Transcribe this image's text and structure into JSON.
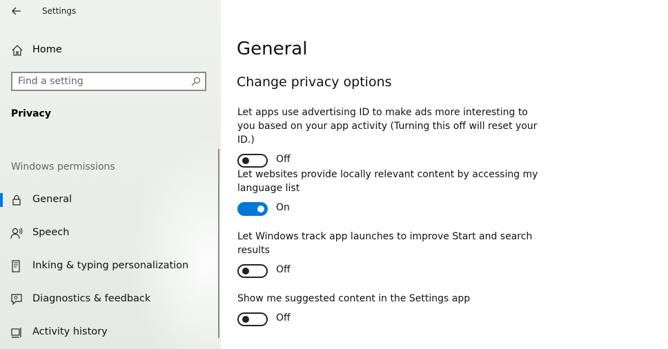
{
  "app": {
    "title": "Settings"
  },
  "sidebar": {
    "home_label": "Home",
    "search_placeholder": "Find a setting",
    "section_title": "Privacy",
    "group_title": "Windows permissions",
    "items": [
      {
        "label": "General",
        "icon": "lock-icon",
        "active": true
      },
      {
        "label": "Speech",
        "icon": "speech-icon",
        "active": false
      },
      {
        "label": "Inking & typing personalization",
        "icon": "inking-icon",
        "active": false
      },
      {
        "label": "Diagnostics & feedback",
        "icon": "feedback-icon",
        "active": false
      },
      {
        "label": "Activity history",
        "icon": "activity-history-icon",
        "active": false
      }
    ]
  },
  "main": {
    "title": "General",
    "subtitle": "Change privacy options",
    "settings": [
      {
        "desc": "Let apps use advertising ID to make ads more interesting to you based on your app activity (Turning this off will reset your ID.)",
        "state": "Off",
        "on": false
      },
      {
        "desc": "Let websites provide locally relevant content by accessing my language list",
        "state": "On",
        "on": true
      },
      {
        "desc": "Let Windows track app launches to improve Start and search results",
        "state": "Off",
        "on": false
      },
      {
        "desc": "Show me suggested content in the Settings app",
        "state": "Off",
        "on": false
      }
    ]
  },
  "colors": {
    "accent": "#0078d7",
    "sidebar_bg": "#e6ebe6"
  }
}
